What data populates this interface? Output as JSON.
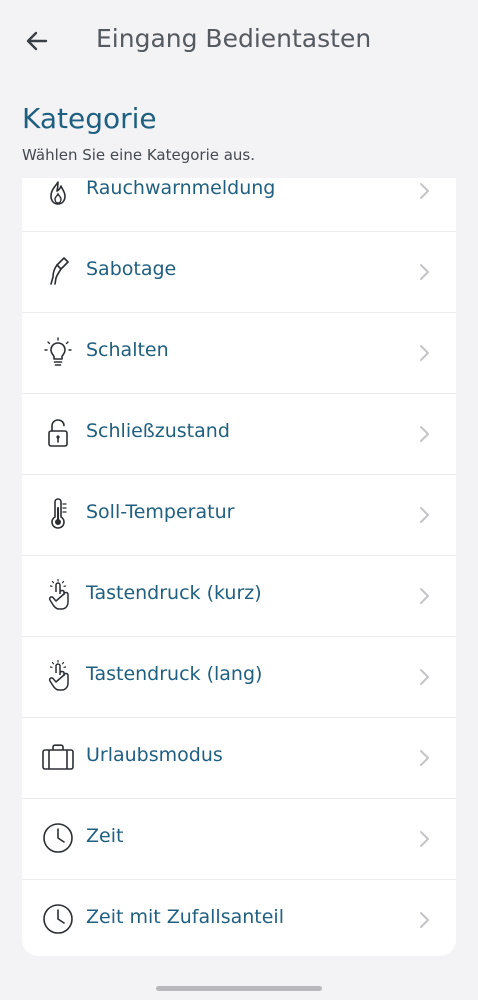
{
  "header": {
    "title": "Eingang Bedientasten",
    "back_icon": "arrow-left-icon"
  },
  "section": {
    "title": "Kategorie",
    "subtitle": "Wählen Sie eine Kategorie aus."
  },
  "categories": [
    {
      "label": "Rauchwarnmeldung",
      "icon": "flame-icon"
    },
    {
      "label": "Sabotage",
      "icon": "pliers-icon"
    },
    {
      "label": "Schalten",
      "icon": "lightbulb-icon"
    },
    {
      "label": "Schließzustand",
      "icon": "padlock-icon"
    },
    {
      "label": "Soll-Temperatur",
      "icon": "thermometer-icon"
    },
    {
      "label": "Tastendruck (kurz)",
      "icon": "finger-press-icon"
    },
    {
      "label": "Tastendruck (lang)",
      "icon": "finger-press-icon"
    },
    {
      "label": "Urlaubsmodus",
      "icon": "suitcase-icon"
    },
    {
      "label": "Zeit",
      "icon": "clock-icon"
    },
    {
      "label": "Zeit mit Zufallsanteil",
      "icon": "clock-icon"
    }
  ],
  "colors": {
    "accent": "#1f5f80",
    "background": "#f3f3f6",
    "card": "#ffffff"
  }
}
